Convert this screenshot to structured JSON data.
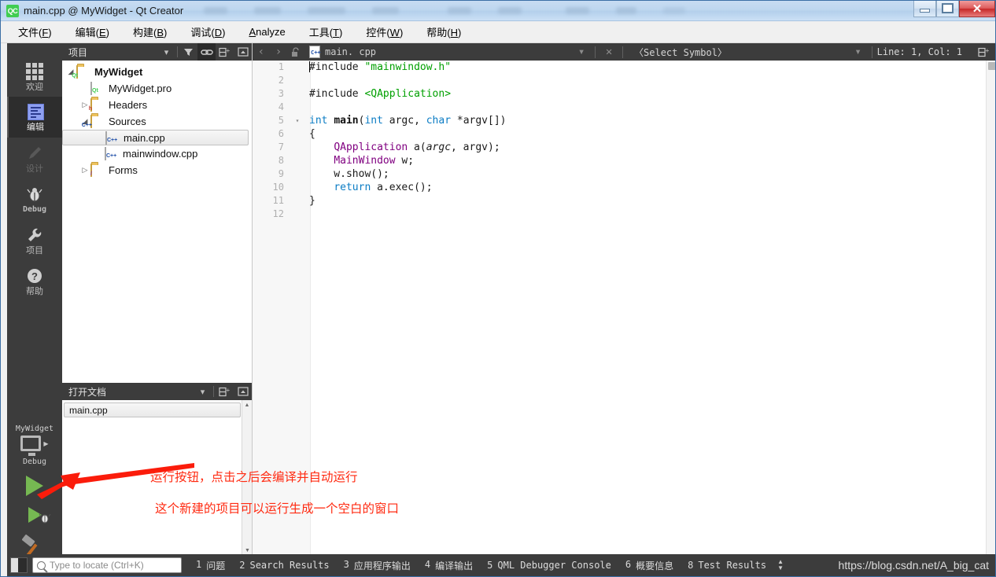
{
  "window": {
    "title": "main.cpp @ MyWidget - Qt Creator",
    "logo": "qt-creator-logo",
    "minimize_label": "",
    "maximize_label": "",
    "close_label": "✕"
  },
  "menubar": {
    "items": [
      {
        "text": "文件(F)",
        "mnemonic": "F"
      },
      {
        "text": "编辑(E)",
        "mnemonic": "E"
      },
      {
        "text": "构建(B)",
        "mnemonic": "B"
      },
      {
        "text": "调试(D)",
        "mnemonic": "D"
      },
      {
        "text": "Analyze",
        "mnemonic": "A"
      },
      {
        "text": "工具(T)",
        "mnemonic": "T"
      },
      {
        "text": "控件(W)",
        "mnemonic": "W"
      },
      {
        "text": "帮助(H)",
        "mnemonic": "H"
      }
    ]
  },
  "modebar": {
    "items": [
      {
        "label": "欢迎",
        "icon": "grid-icon",
        "state": "normal"
      },
      {
        "label": "编辑",
        "icon": "document-icon",
        "state": "active"
      },
      {
        "label": "设计",
        "icon": "pencil-icon",
        "state": "disabled"
      },
      {
        "label": "Debug",
        "icon": "bug-icon",
        "state": "normal"
      },
      {
        "label": "项目",
        "icon": "wrench-icon",
        "state": "normal"
      },
      {
        "label": "帮助",
        "icon": "question-icon",
        "state": "normal"
      }
    ]
  },
  "runarea": {
    "kit_name": "MyWidget",
    "build_config": "Debug",
    "run_button_title": "run-button",
    "debug_button_title": "debug-button",
    "build_button_title": "build-button"
  },
  "project_panel": {
    "title": "项目",
    "toolbar": [
      "filter-icon",
      "link-icon",
      "split-icon",
      "collapse-icon"
    ],
    "tree": [
      {
        "label": "MyWidget",
        "icon": "qt-project-folder",
        "indent": 0,
        "twisty": "open",
        "bold": true,
        "selected": false
      },
      {
        "label": "MyWidget.pro",
        "icon": "qt-pro-file",
        "indent": 1,
        "twisty": "none",
        "bold": false,
        "selected": false
      },
      {
        "label": "Headers",
        "icon": "headers-folder",
        "indent": 1,
        "twisty": "closed",
        "bold": false,
        "selected": false
      },
      {
        "label": "Sources",
        "icon": "sources-folder",
        "indent": 1,
        "twisty": "open",
        "bold": false,
        "selected": false
      },
      {
        "label": "main.cpp",
        "icon": "cpp-file",
        "indent": 2,
        "twisty": "none",
        "bold": false,
        "selected": true
      },
      {
        "label": "mainwindow.cpp",
        "icon": "cpp-file",
        "indent": 2,
        "twisty": "none",
        "bold": false,
        "selected": false
      },
      {
        "label": "Forms",
        "icon": "forms-folder",
        "indent": 1,
        "twisty": "closed",
        "bold": false,
        "selected": false
      }
    ]
  },
  "open_documents": {
    "title": "打开文档",
    "toolbar": [
      "split-icon",
      "collapse-icon"
    ],
    "items": [
      {
        "label": "main.cpp",
        "selected": true
      }
    ]
  },
  "editor_toolbar": {
    "back_icon": "‹",
    "forward_icon": "›",
    "lock_icon": "unlock-icon",
    "file_name": "main. cpp",
    "dropdown_icon": "▾",
    "close_icon": "✕",
    "symbol_selector": "〈Select Symbol〉",
    "line_col": "Line: 1, Col: 1",
    "split_icon": "split-icon"
  },
  "editor": {
    "lines": [
      {
        "no": "1",
        "fold": "",
        "tokens": [
          {
            "t": "caret",
            "v": ""
          },
          {
            "t": "pre",
            "v": "#include "
          },
          {
            "t": "str",
            "v": "\"mainwindow.h\""
          }
        ]
      },
      {
        "no": "2",
        "fold": "",
        "tokens": []
      },
      {
        "no": "3",
        "fold": "",
        "tokens": [
          {
            "t": "pre",
            "v": "#include "
          },
          {
            "t": "str",
            "v": "<QApplication>"
          }
        ]
      },
      {
        "no": "4",
        "fold": "",
        "tokens": []
      },
      {
        "no": "5",
        "fold": "▾",
        "tokens": [
          {
            "t": "kw",
            "v": "int"
          },
          {
            "t": "plain",
            "v": " "
          },
          {
            "t": "fn",
            "v": "main"
          },
          {
            "t": "plain",
            "v": "("
          },
          {
            "t": "kw",
            "v": "int"
          },
          {
            "t": "plain",
            "v": " argc, "
          },
          {
            "t": "kw",
            "v": "char"
          },
          {
            "t": "plain",
            "v": " *argv[])"
          }
        ]
      },
      {
        "no": "6",
        "fold": "",
        "tokens": [
          {
            "t": "plain",
            "v": "{"
          }
        ]
      },
      {
        "no": "7",
        "fold": "",
        "tokens": [
          {
            "t": "plain",
            "v": "    "
          },
          {
            "t": "type",
            "v": "QApplication"
          },
          {
            "t": "plain",
            "v": " a("
          },
          {
            "t": "it",
            "v": "argc"
          },
          {
            "t": "plain",
            "v": ", argv);"
          }
        ]
      },
      {
        "no": "8",
        "fold": "",
        "tokens": [
          {
            "t": "plain",
            "v": "    "
          },
          {
            "t": "type",
            "v": "MainWindow"
          },
          {
            "t": "plain",
            "v": " w;"
          }
        ]
      },
      {
        "no": "9",
        "fold": "",
        "tokens": [
          {
            "t": "plain",
            "v": "    w."
          },
          {
            "t": "mth",
            "v": "show"
          },
          {
            "t": "plain",
            "v": "();"
          }
        ]
      },
      {
        "no": "10",
        "fold": "",
        "tokens": [
          {
            "t": "plain",
            "v": "    "
          },
          {
            "t": "kw",
            "v": "return"
          },
          {
            "t": "plain",
            "v": " a."
          },
          {
            "t": "mth",
            "v": "exec"
          },
          {
            "t": "plain",
            "v": "();"
          }
        ]
      },
      {
        "no": "11",
        "fold": "",
        "tokens": [
          {
            "t": "plain",
            "v": "}"
          }
        ]
      },
      {
        "no": "12",
        "fold": "",
        "tokens": []
      }
    ],
    "colors": {
      "string": "#00a000",
      "keyword": "#0b7cc4",
      "type": "#800080",
      "text": "#1a1a1a",
      "line_number": "#b0b0b0",
      "background": "#ffffff",
      "gutter_background": "#f7f7f7"
    }
  },
  "annotations": {
    "line1": "运行按钮，点击之后会编译并自动运行",
    "line2": "这个新建的项目可以运行生成一个空白的窗口",
    "color": "#ff2a11",
    "arrow": "red-arrow"
  },
  "statusbar": {
    "sidebar_toggle": "sidebar-toggle-icon",
    "locator_placeholder": "Type to locate (Ctrl+K)",
    "locator_value": "",
    "panes": [
      {
        "num": "1",
        "label": "问题"
      },
      {
        "num": "2",
        "label": "Search Results"
      },
      {
        "num": "3",
        "label": "应用程序输出"
      },
      {
        "num": "4",
        "label": "编译输出"
      },
      {
        "num": "5",
        "label": "QML Debugger Console"
      },
      {
        "num": "6",
        "label": "概要信息"
      },
      {
        "num": "8",
        "label": "Test Results"
      }
    ],
    "watermark": "https://blog.csdn.net/A_big_cat"
  }
}
